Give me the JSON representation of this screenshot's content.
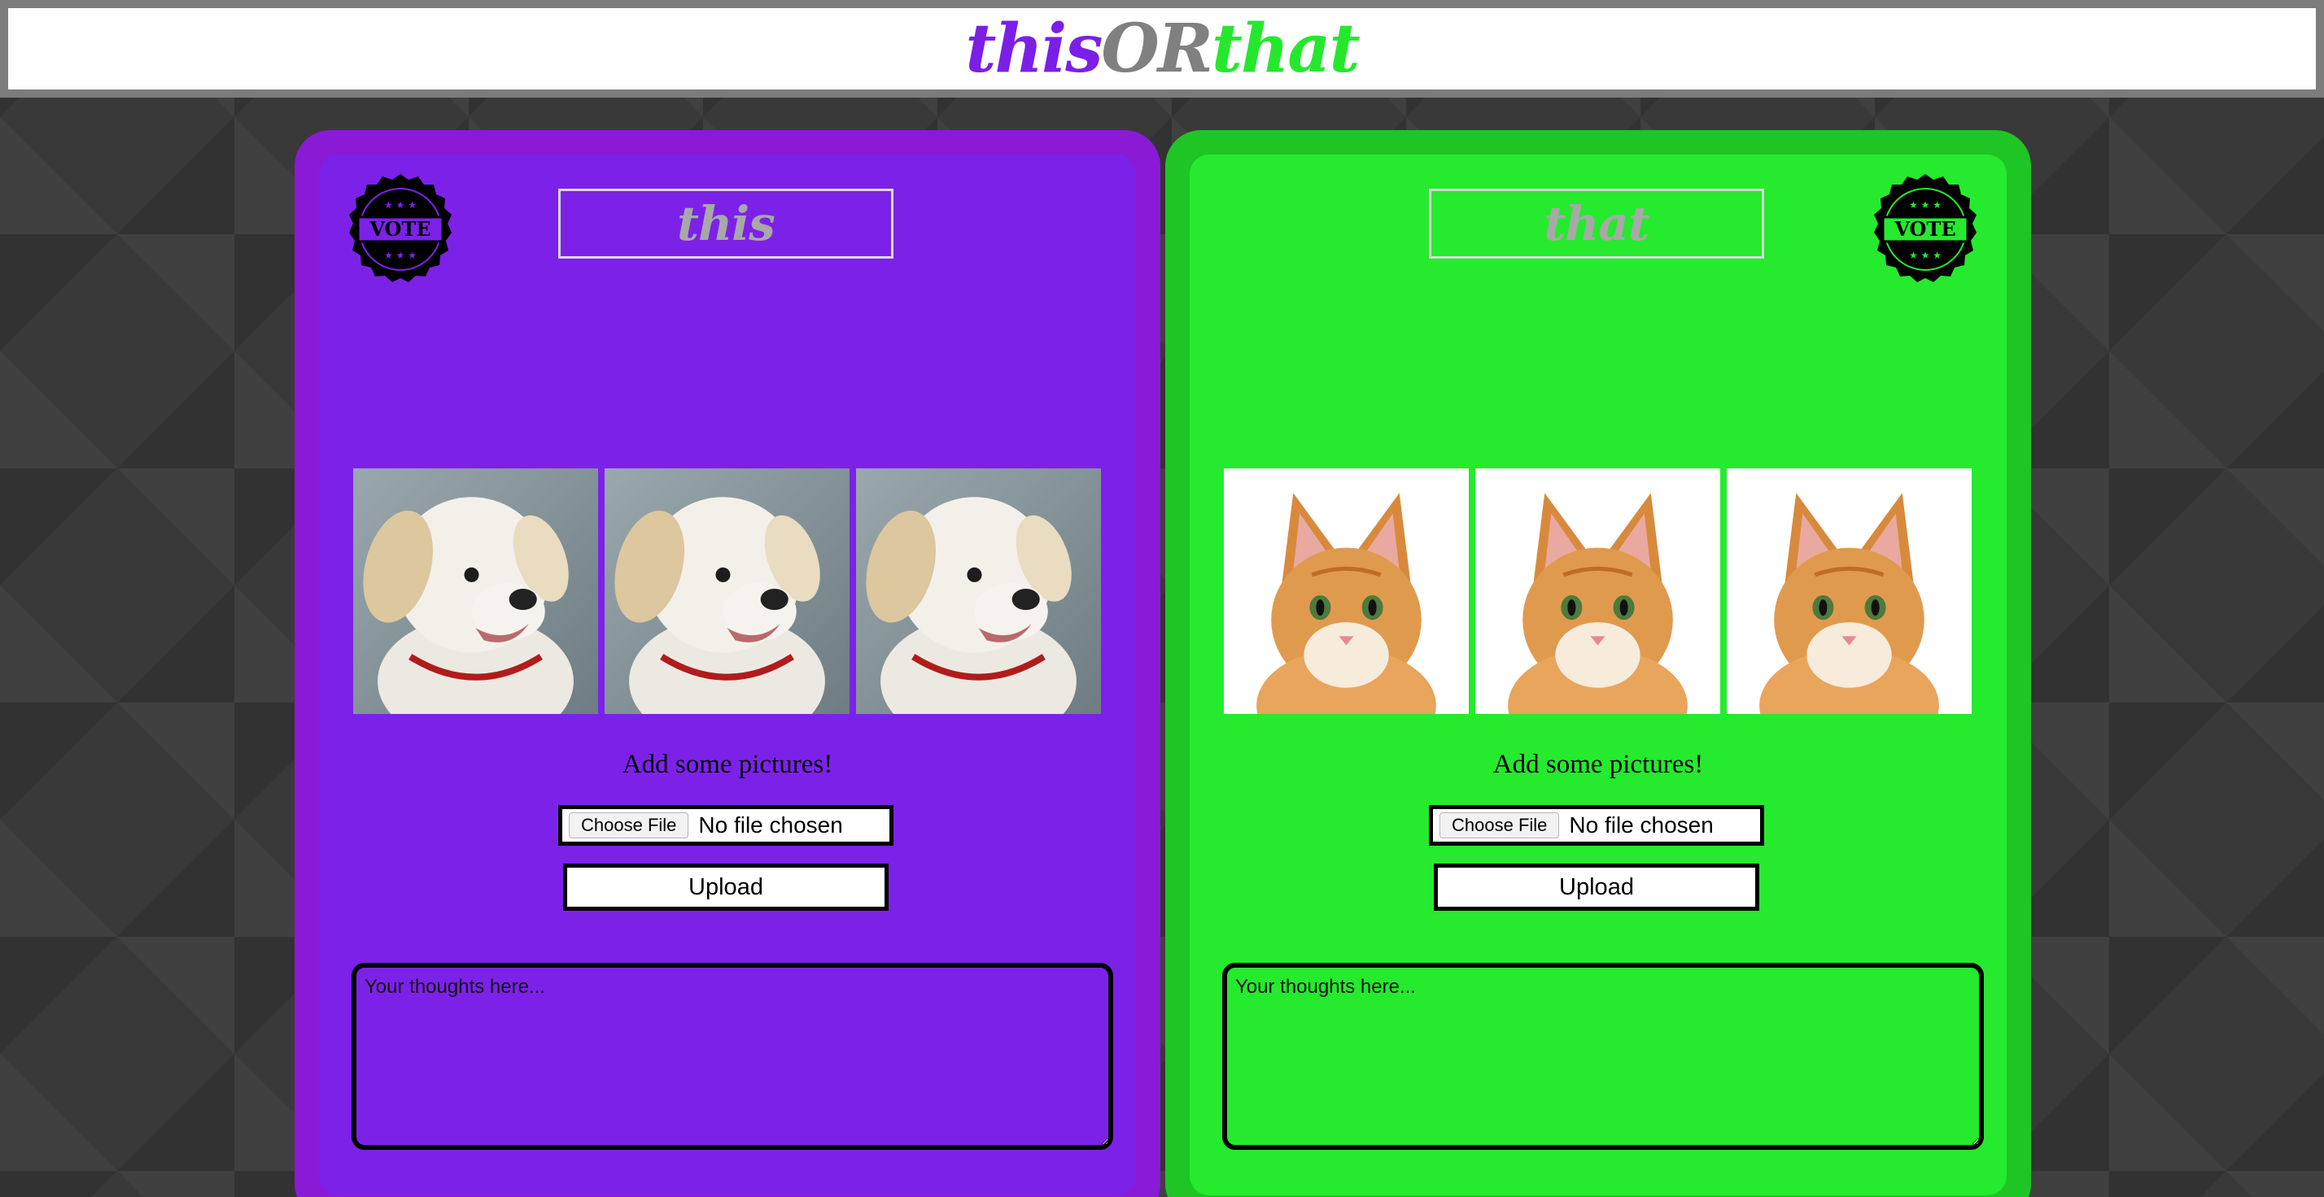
{
  "logo": {
    "part1": "this",
    "part2": "OR",
    "part3": "that"
  },
  "panels": [
    {
      "title": "this",
      "vote_badge": "VOTE",
      "image_subject": "puppy",
      "hint": "Add some pictures!",
      "choose_file": "Choose File",
      "file_status": "No file chosen",
      "upload": "Upload",
      "thoughts_placeholder": "Your thoughts here..."
    },
    {
      "title": "that",
      "vote_badge": "VOTE",
      "image_subject": "kitten",
      "hint": "Add some pictures!",
      "choose_file": "Choose File",
      "file_status": "No file chosen",
      "upload": "Upload",
      "thoughts_placeholder": "Your thoughts here..."
    }
  ],
  "colors": {
    "this_accent": "#7c22e8",
    "that_accent": "#25ea2e",
    "or_gray": "#808080"
  }
}
